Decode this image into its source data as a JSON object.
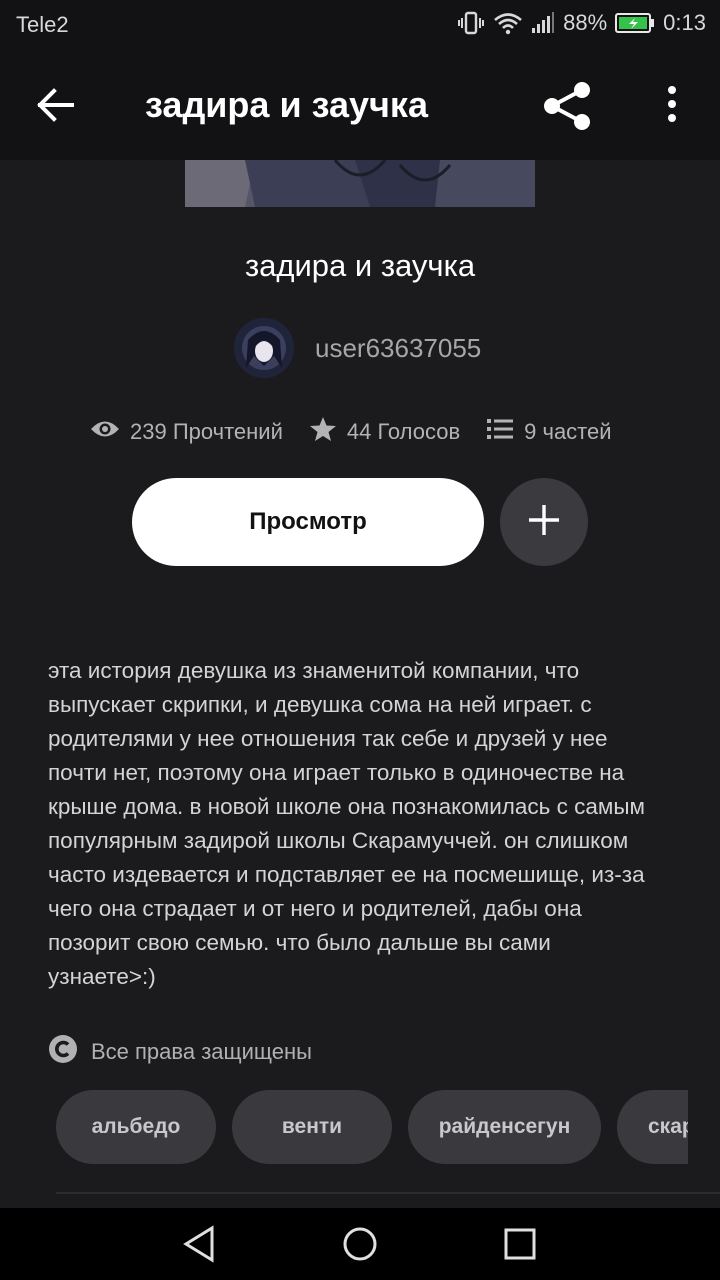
{
  "status_bar": {
    "carrier": "Tele2",
    "battery_percent": "88%",
    "time": "0:13",
    "icons": [
      "vibrate-icon",
      "wifi-icon",
      "signal-icon",
      "battery-icon"
    ]
  },
  "app_bar": {
    "title": "задира и заучка",
    "icons": [
      "back-arrow-icon",
      "share-icon",
      "more-vert-icon"
    ]
  },
  "story": {
    "title": "задира и заучка",
    "author": "user63637055",
    "stats": {
      "reads": "239 Прочтений",
      "votes": "44 Голосов",
      "parts": "9 частей"
    },
    "read_button": "Просмотр",
    "description": "эта история девушка из знаменитой компании, что выпускает скрипки, и девушка сома на ней играет. с родителями у нее отношения так себе и друзей у нее почти нет, поэтому она играет только в одиночестве на крыше дома. в новой школе она познакомилась с самым популярным задирой школы Скарамуччей. он слишком часто издевается и подставляет ее на посмешище, из-за чего она страдает и от него и родителей, дабы она позорит свою семью. что было дальше вы сами узнаете>:)",
    "copyright": "Все права защищены",
    "tags": [
      "альбедо",
      "венти",
      "райденсегун",
      "скар"
    ]
  },
  "colors": {
    "background": "#1b1a1d",
    "bar_background": "#121114",
    "button_primary": "#ffffff",
    "tag_background": "#3a393d"
  }
}
